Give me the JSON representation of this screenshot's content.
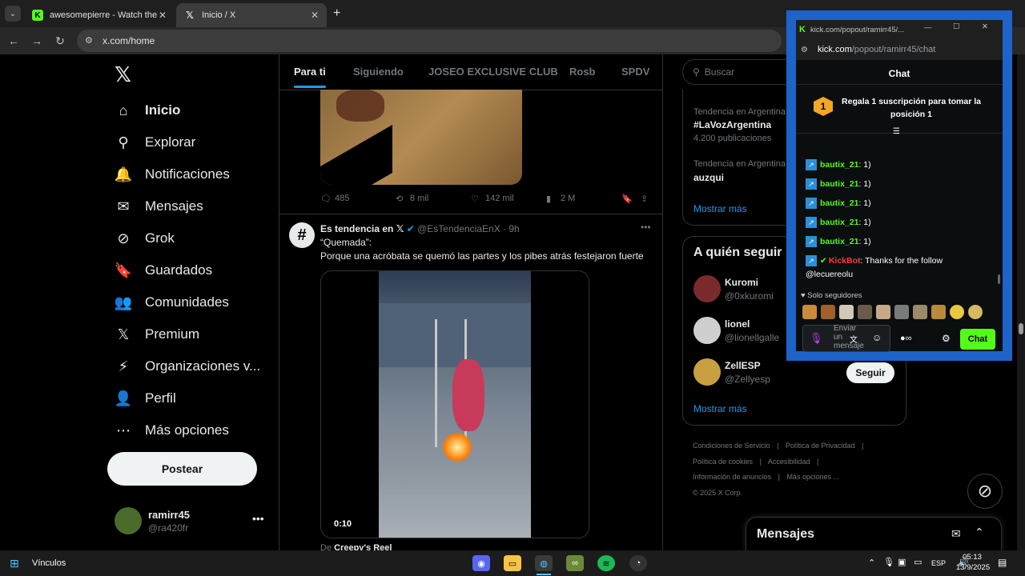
{
  "browser": {
    "tabs": [
      {
        "title": "awesomepierre - Watch the VO",
        "active": false
      },
      {
        "title": "Inicio / X",
        "active": true
      }
    ],
    "address": "x.com/home"
  },
  "sidebar": {
    "items": [
      {
        "label": "Inicio",
        "icon": "home-icon",
        "glyph": "⌂"
      },
      {
        "label": "Explorar",
        "icon": "search-icon",
        "glyph": "⚲"
      },
      {
        "label": "Notificaciones",
        "icon": "bell-icon",
        "glyph": "🔔"
      },
      {
        "label": "Mensajes",
        "icon": "mail-icon",
        "glyph": "✉"
      },
      {
        "label": "Grok",
        "icon": "grok-icon",
        "glyph": "⊘"
      },
      {
        "label": "Guardados",
        "icon": "bookmark-icon",
        "glyph": "🔖"
      },
      {
        "label": "Comunidades",
        "icon": "communities-icon",
        "glyph": "👥"
      },
      {
        "label": "Premium",
        "icon": "x-logo-icon",
        "glyph": "𝕏"
      },
      {
        "label": "Organizaciones v...",
        "icon": "lightning-icon",
        "glyph": "⚡"
      },
      {
        "label": "Perfil",
        "icon": "person-icon",
        "glyph": "👤"
      },
      {
        "label": "Más opciones",
        "icon": "more-circle-icon",
        "glyph": "⋯"
      }
    ],
    "post_label": "Postear",
    "user": {
      "name": "ramirr45",
      "handle": "@ra420fr"
    }
  },
  "feed": {
    "tabs": [
      "Para ti",
      "Siguiendo",
      "JOSEO EXCLUSIVE CLUB",
      "Rosb",
      "SPDV"
    ],
    "first_post_stats": {
      "replies": "485",
      "reposts": "8 mil",
      "likes": "142 mil",
      "views": "2 M"
    },
    "second_post": {
      "name": "Es tendencia en 𝕏",
      "handle": "@EsTendenciaEnX",
      "time": "· 9h",
      "line1": "“Quemada”:",
      "line2": "Porque una acróbata se quemó las partes y los pibes atrás festejaron fuerte",
      "video_time": "0:10",
      "from": "De",
      "from_name": "Creepy's Reel"
    }
  },
  "right": {
    "search_placeholder": "Buscar",
    "trends": [
      {
        "context": "Tendencia en Argentina",
        "name": "#LaVozArgentina",
        "count": "4.200 publicaciones"
      },
      {
        "context": "Tendencia en Argentina",
        "name": "auzqui",
        "count": ""
      }
    ],
    "show_more": "Mostrar más",
    "who_to_follow": "A quién seguir",
    "follow": [
      {
        "name": "Kuromi",
        "handle": "@0xkuromi",
        "color": "#7a2a2a"
      },
      {
        "name": "lionel",
        "handle": "@lionellgalle",
        "color": "#d9d9d9"
      },
      {
        "name": "ZellESP",
        "handle": "@Zellyesp",
        "color": "#c8a040"
      }
    ],
    "follow_label": "Seguir",
    "show_more2": "Mostrar más",
    "footer": [
      "Condiciones de Servicio",
      "Política de Privacidad",
      "Política de cookies",
      "Accesibilidad",
      "Información de anuncios",
      "Más opciones ...",
      "© 2025 X Corp."
    ],
    "messages": "Mensajes"
  },
  "kick": {
    "window_title": "kick.com/popout/ramirr45/...",
    "url_host": "kick.com",
    "url_path": "/popout/ramirr45/chat",
    "chat_title": "Chat",
    "gift_rank": "1",
    "gift_text": "Regala 1 suscripción para tomar la posición 1",
    "lines": [
      {
        "user": "bautix_21",
        "msg": ": 1)"
      },
      {
        "user": "bautix_21",
        "msg": ": 1)"
      },
      {
        "user": "bautix_21",
        "msg": ": 1)"
      },
      {
        "user": "bautix_21",
        "msg": ": 1)"
      },
      {
        "user": "bautix_21",
        "msg": ": 1)"
      }
    ],
    "kickbot_user": "KickBot",
    "kickbot_msg": ": Thanks for the follow",
    "kickbot_msg2": "@lecuereolu",
    "followers_only": "Solo seguidores",
    "input_placeholder": "Enviar un mensaje",
    "send_label": "Chat"
  },
  "taskbar": {
    "links": "Vínculos",
    "lang": "ESP",
    "time": "05:13",
    "date": "13/9/2025"
  }
}
